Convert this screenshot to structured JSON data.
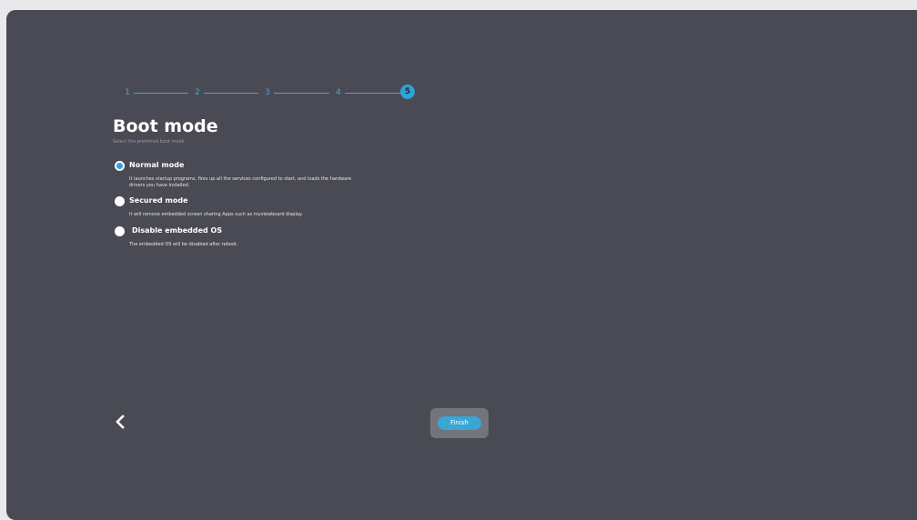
{
  "stepper": {
    "steps": [
      "1",
      "2",
      "3",
      "4",
      "5"
    ],
    "current_step": "5"
  },
  "page": {
    "title": "Boot mode",
    "subtitle": "Select the preferred boot mode"
  },
  "options": [
    {
      "label": "Normal mode",
      "description": "It launches startup programs, fires up all the services configured to start, and loads the hardware drivers you have installed.",
      "selected": true
    },
    {
      "label": "Secured mode",
      "description": "It will remove embedded screen sharing Apps such as myviewboard display.",
      "selected": false
    },
    {
      "label": "Disable embedded OS",
      "description": "The embedded OS will be disabled after reboot.",
      "selected": false
    }
  ],
  "footer": {
    "finish_label": "Finish",
    "back_icon": "chevron-left-icon"
  },
  "colors": {
    "background": "#4a4a54",
    "accent": "#2fa3d6",
    "text": "#ffffff"
  }
}
